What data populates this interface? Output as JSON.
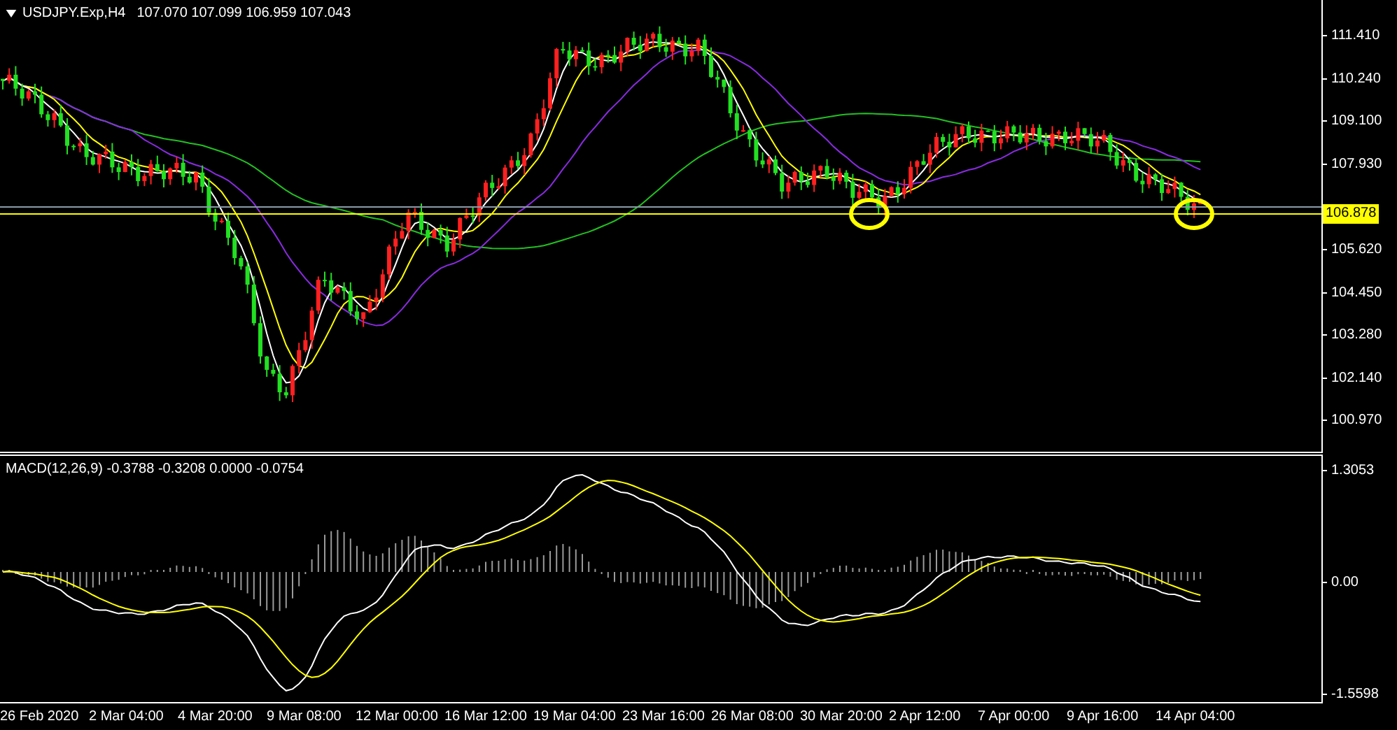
{
  "chart_header": {
    "symbol": "USDJPY.Exp,H4",
    "ohlc": "107.070 107.099 106.959 107.043"
  },
  "price_axis": [
    "111.410",
    "110.240",
    "109.100",
    "107.930",
    "105.620",
    "104.450",
    "103.280",
    "102.140",
    "100.970"
  ],
  "current_price": "106.878",
  "macd_header": "MACD(12,26,9) -0.3788 -0.3208 0.0000 -0.0754",
  "macd_axis": [
    "1.3053",
    "0.00",
    "-1.5598"
  ],
  "time_axis": [
    "26 Feb 2020",
    "2 Mar 04:00",
    "4 Mar 20:00",
    "9 Mar 08:00",
    "12 Mar 00:00",
    "16 Mar 12:00",
    "19 Mar 04:00",
    "23 Mar 16:00",
    "26 Mar 08:00",
    "30 Mar 20:00",
    "2 Apr 12:00",
    "7 Apr 00:00",
    "9 Apr 16:00",
    "14 Apr 04:00"
  ]
}
